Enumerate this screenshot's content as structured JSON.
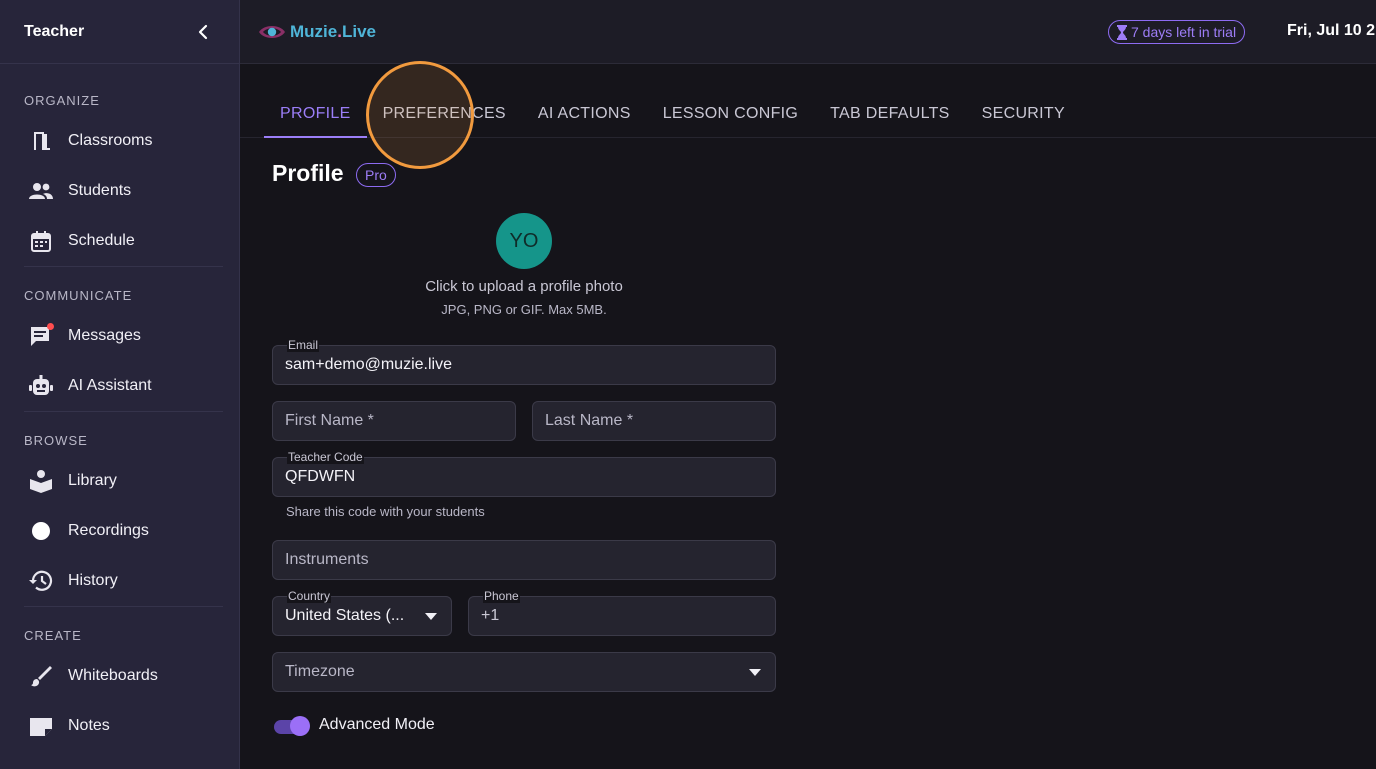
{
  "sidebar": {
    "title": "Teacher",
    "sections": {
      "organize": "ORGANIZE",
      "communicate": "COMMUNICATE",
      "browse": "BROWSE",
      "create": "CREATE"
    },
    "items": {
      "classrooms": "Classrooms",
      "students": "Students",
      "schedule": "Schedule",
      "messages": "Messages",
      "ai_assistant": "AI Assistant",
      "library": "Library",
      "recordings": "Recordings",
      "history": "History",
      "whiteboards": "Whiteboards",
      "notes": "Notes"
    },
    "icons": [
      "chevron-left-icon",
      "classroom-door-icon",
      "people-icon",
      "calendar-icon",
      "message-icon",
      "robot-icon",
      "book-reader-icon",
      "record-dot-icon",
      "history-icon",
      "brush-icon",
      "note-icon"
    ]
  },
  "topbar": {
    "brand_main": "Muzie",
    "brand_dot": ".",
    "brand_suffix": "Live",
    "trial": "7 days left in trial",
    "date": "Fri, Jul 10 2"
  },
  "tabs": {
    "profile": "PROFILE",
    "preferences": "PREFERENCES",
    "ai_actions": "AI ACTIONS",
    "lesson_config": "LESSON CONFIG",
    "tab_defaults": "TAB DEFAULTS",
    "security": "SECURITY",
    "active": "PROFILE"
  },
  "profile": {
    "title": "Profile",
    "badge": "Pro",
    "avatar_initials": "YO",
    "upload_hint": "Click to upload a profile photo",
    "upload_sub": "JPG, PNG or GIF. Max 5MB.",
    "email_label": "Email",
    "email_value": "sam+demo@muzie.live",
    "first_name_placeholder": "First Name *",
    "last_name_placeholder": "Last Name *",
    "teacher_code_label": "Teacher Code",
    "teacher_code_value": "QFDWFN",
    "teacher_code_helper": "Share this code with your students",
    "instruments_placeholder": "Instruments",
    "country_label": "Country",
    "country_value": "United States (...",
    "phone_label": "Phone",
    "phone_value": "+1",
    "timezone_placeholder": "Timezone",
    "advanced_mode_label": "Advanced Mode",
    "advanced_mode_on": true
  },
  "colors": {
    "accent": "#9b7ef8",
    "sidebar_bg": "#27253a",
    "avatar_bg": "#15958a",
    "click_marker": "#f19a3e"
  }
}
